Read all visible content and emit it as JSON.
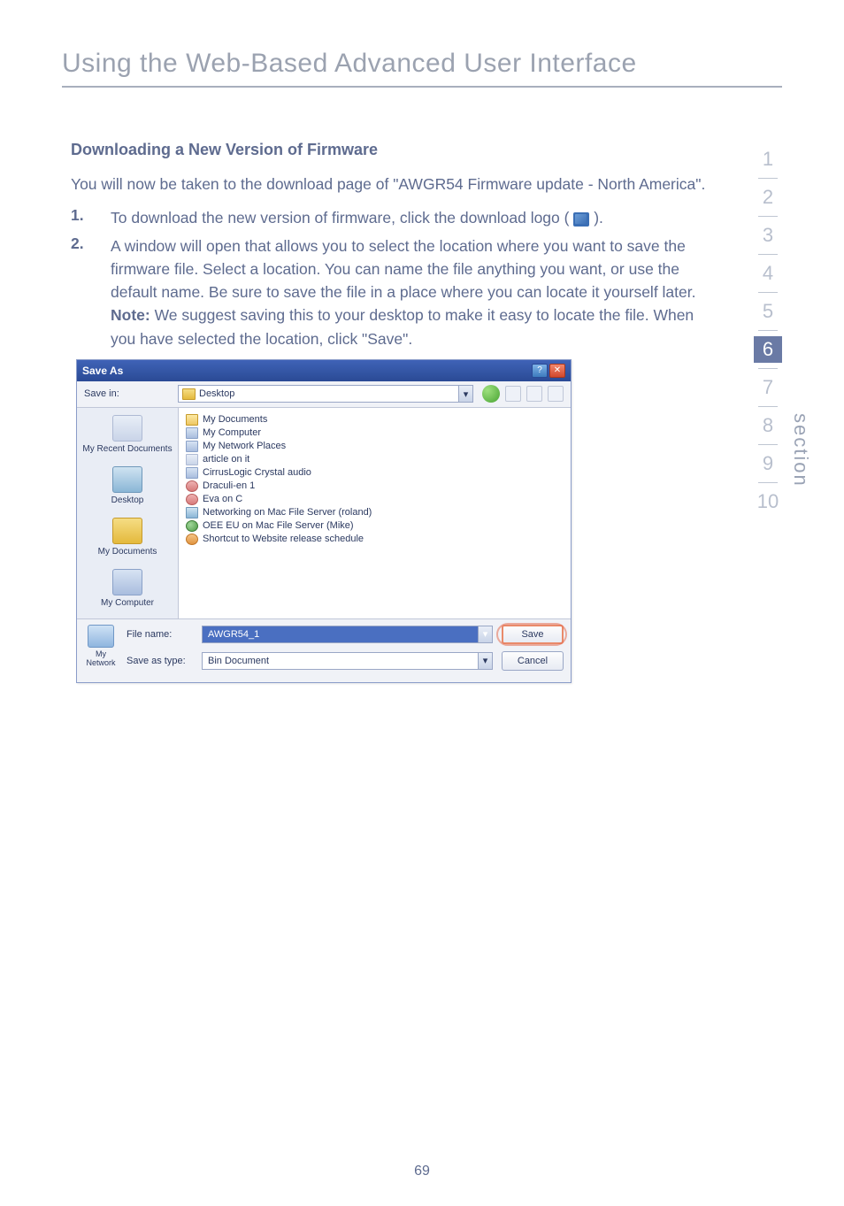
{
  "title": "Using the Web-Based Advanced User Interface",
  "subtitle": "Downloading a New Version of Firmware",
  "intro": "You will now be taken to the download page of \"AWGR54 Firmware update - North America\".",
  "items": [
    {
      "num": "1.",
      "text_before": "To download the new version of firmware, click the download logo (",
      "text_after": ")."
    },
    {
      "num": "2.",
      "text": "A window will open that allows you to select the location where you want to save the firmware file. Select a location. You can name the file anything you want, or use the default name. Be sure to save the file in a place where you can locate it yourself later.",
      "note_label": "Note:",
      "note": " We suggest saving this to your desktop to make it easy to locate the file. When you have selected the location, click \"Save\"."
    }
  ],
  "section": {
    "label": "section",
    "numbers": [
      "1",
      "2",
      "3",
      "4",
      "5",
      "6",
      "7",
      "8",
      "9",
      "10"
    ],
    "active": "6"
  },
  "dialog": {
    "title": "Save As",
    "help_btn": "?",
    "close_btn": "✕",
    "savein_label": "Save in:",
    "savein_value": "Desktop",
    "places": [
      {
        "icon": "recent",
        "label": "My Recent Documents"
      },
      {
        "icon": "desktop",
        "label": "Desktop"
      },
      {
        "icon": "docs",
        "label": "My Documents"
      },
      {
        "icon": "comp",
        "label": "My Computer"
      }
    ],
    "files": [
      {
        "icon": "folder-open",
        "label": "My Documents"
      },
      {
        "icon": "system",
        "label": "My Computer"
      },
      {
        "icon": "system",
        "label": "My Network Places"
      },
      {
        "icon": "pdf",
        "label": "article on it"
      },
      {
        "icon": "system",
        "label": "CirrusLogic Crystal audio"
      },
      {
        "icon": "red",
        "label": "Draculi-en 1"
      },
      {
        "icon": "red",
        "label": "Eva on C"
      },
      {
        "icon": "net",
        "label": "Networking on Mac File Server (roland)"
      },
      {
        "icon": "earth",
        "label": "OEE EU on Mac File Server (Mike)"
      },
      {
        "icon": "orange",
        "label": "Shortcut to Website release schedule"
      }
    ],
    "bottom_icon_label": "My Network",
    "filename_label": "File name:",
    "filename_value": "AWGR54_1",
    "saveastype_label": "Save as type:",
    "saveastype_value": "Bin Document",
    "save_btn": "Save",
    "cancel_btn": "Cancel"
  },
  "page_number": "69"
}
